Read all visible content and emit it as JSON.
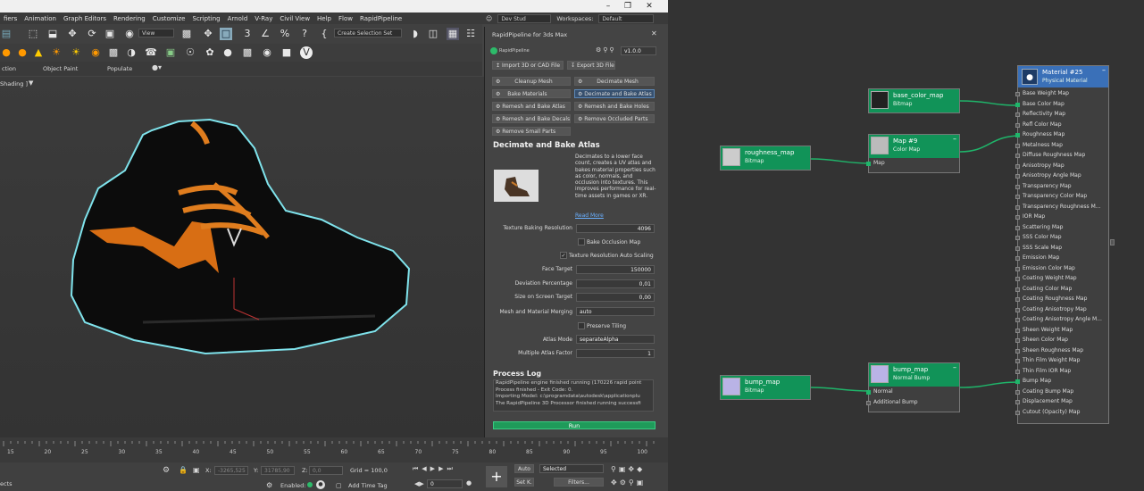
{
  "menu": [
    "fiers",
    "Animation",
    "Graph Editors",
    "Rendering",
    "Customize",
    "Scripting",
    "Arnold",
    "V-Ray",
    "Civil View",
    "Help",
    "Flow",
    "RapidPipeline"
  ],
  "workspace": {
    "user": "Dev Stud",
    "label": "Workspaces:",
    "value": "Default"
  },
  "toolbar": {
    "view_combo": "View",
    "selection_set": "Create Selection Set"
  },
  "ribbon": {
    "tab1": "ction",
    "tab2": "Object Paint",
    "tab3": "Populate"
  },
  "viewport": {
    "label": "Shading ]"
  },
  "rapid": {
    "title": "RapidPipeline for 3ds Max",
    "logo": "RapidPipeline",
    "version": "v1.0.0",
    "import_btn": "Import 3D or CAD File",
    "export_btn": "Export 3D File",
    "ops": [
      {
        "label": "Cleanup Mesh"
      },
      {
        "label": "Decimate Mesh"
      },
      {
        "label": "Bake Materials"
      },
      {
        "label": "Decimate and Bake Atlas"
      },
      {
        "label": "Remesh and Bake Atlas"
      },
      {
        "label": "Remesh and Bake Holes"
      },
      {
        "label": "Remesh and Bake Decals"
      },
      {
        "label": "Remove Occluded Parts"
      },
      {
        "label": "Remove Small Parts"
      }
    ],
    "section_title": "Decimate and Bake Atlas",
    "description": "Decimates to a lower face count, creates a UV atlas and bakes material properties such as color, normals, and occlusion into textures. This improves performance for real-time assets in games or XR.",
    "read_more": "Read More",
    "params": {
      "tex_res_label": "Texture Baking Resolution",
      "tex_res_value": "4096",
      "bake_occ_label": "Bake Occlusion Map",
      "auto_scale_label": "Texture Resolution Auto Scaling",
      "face_target_label": "Face Target",
      "face_target_value": "150000",
      "deviation_label": "Deviation Percentage",
      "deviation_value": "0,01",
      "screen_size_label": "Size on Screen Target",
      "screen_size_value": "0,00",
      "merging_label": "Mesh and Material Merging",
      "merging_value": "auto",
      "preserve_label": "Preserve Tiling",
      "atlas_mode_label": "Atlas Mode",
      "atlas_mode_value": "separateAlpha",
      "atlas_factor_label": "Multiple Atlas Factor",
      "atlas_factor_value": "1"
    },
    "log_title": "Process Log",
    "log_lines": [
      "RapidPipeline engine finished running (170226 rapid point",
      "Process finished - Exit Code: 0.",
      "Importing Model: c:\\programdata\\autodesk\\applicationplu",
      "The RapidPipeline 3D Processor finished running successfi"
    ],
    "run": "Run"
  },
  "timeline": {
    "ticks": [
      "15",
      "20",
      "25",
      "30",
      "35",
      "40",
      "45",
      "50",
      "55",
      "60",
      "65",
      "70",
      "75",
      "80",
      "85",
      "90",
      "95",
      "100"
    ]
  },
  "status": {
    "x_label": "X:",
    "x_value": "-3265,525",
    "y_label": "Y:",
    "y_value": "31785,90",
    "z_label": "Z:",
    "z_value": "0,0",
    "grid": "Grid = 100,0",
    "enabled": "Enabled:",
    "add_time_tag": "Add Time Tag",
    "auto": "Auto",
    "selected": "Selected",
    "set_key": "Set K.",
    "filters": "Filters...",
    "frame": "0",
    "left_text": "ects"
  },
  "nodes": {
    "material": {
      "title": "Material #25",
      "sub": "Physical Material",
      "ports": [
        "Base Weight Map",
        "Base Color Map",
        "Reflectivity Map",
        "Refl Color Map",
        "Roughness Map",
        "Metalness Map",
        "Diffuse Roughness Map",
        "Anisotropy Map",
        "Anisotropy Angle Map",
        "Transparency Map",
        "Transparency Color Map",
        "Transparency Roughness M...",
        "IOR Map",
        "Scattering Map",
        "SSS Color Map",
        "SSS Scale Map",
        "Emission Map",
        "Emission Color Map",
        "Coating Weight Map",
        "Coating Color Map",
        "Coating Roughness Map",
        "Coating Anisotropy Map",
        "Coating Anisotropy Angle M...",
        "Sheen Weight Map",
        "Sheen Color Map",
        "Sheen Roughness Map",
        "Thin Film Weight Map",
        "Thin Film IOR Map",
        "Bump Map",
        "Coating Bump Map",
        "Displacement Map",
        "Cutout (Opacity) Map"
      ]
    },
    "base_color": {
      "title": "base_color_map",
      "sub": "Bitmap"
    },
    "map9": {
      "title": "Map #9",
      "sub": "Color Map",
      "port": "Map"
    },
    "roughness": {
      "title": "roughness_map",
      "sub": "Bitmap"
    },
    "bump": {
      "title": "bump_map",
      "sub": "Bitmap"
    },
    "normal_bump": {
      "title": "bump_map",
      "sub": "Normal Bump",
      "ports": [
        "Normal",
        "Additional Bump"
      ]
    }
  },
  "colors": {
    "node_green": "#119358",
    "node_blue": "#3a70b8",
    "accent_blue": "#5c87b6",
    "wire": "#1fb56a"
  }
}
